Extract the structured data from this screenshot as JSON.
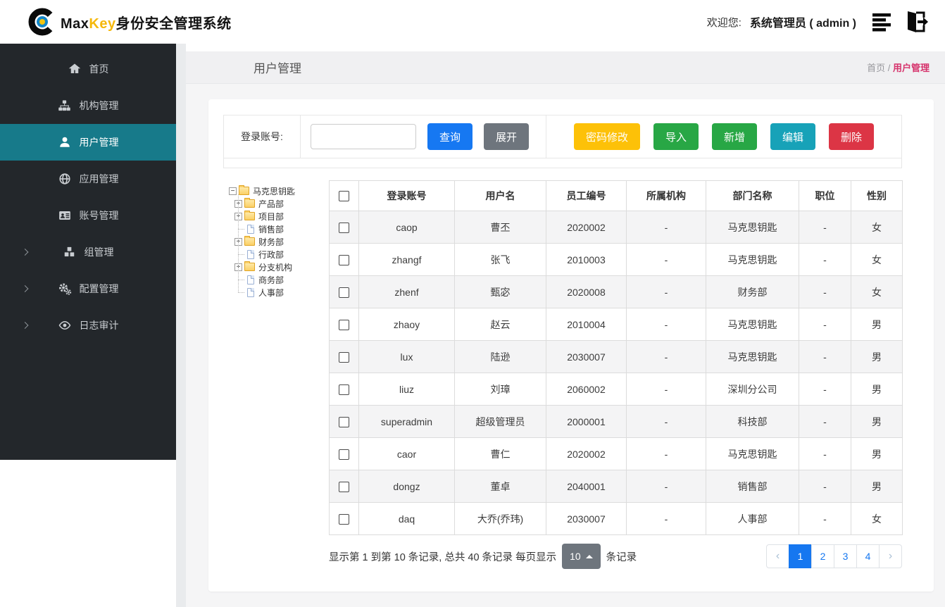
{
  "header": {
    "brand_max": "Max",
    "brand_key": "Key",
    "brand_suffix": "身份安全管理系统",
    "welcome_label": "欢迎您:",
    "welcome_user": "系统管理员 ( admin )",
    "icons": [
      "menu-lines-icon",
      "logout-icon"
    ]
  },
  "sidebar": {
    "items": [
      {
        "label": "首页",
        "icon": "home-icon",
        "active": false,
        "chevron": false
      },
      {
        "label": "机构管理",
        "icon": "sitemap-icon",
        "active": false,
        "chevron": false
      },
      {
        "label": "用户管理",
        "icon": "user-icon",
        "active": true,
        "chevron": false
      },
      {
        "label": "应用管理",
        "icon": "globe-icon",
        "active": false,
        "chevron": false
      },
      {
        "label": "账号管理",
        "icon": "id-card-icon",
        "active": false,
        "chevron": false
      },
      {
        "label": "组管理",
        "icon": "cubes-icon",
        "active": false,
        "chevron": true
      },
      {
        "label": "配置管理",
        "icon": "gears-icon",
        "active": false,
        "chevron": true
      },
      {
        "label": "日志审计",
        "icon": "eye-icon",
        "active": false,
        "chevron": true
      }
    ],
    "active_color": "#177a8a"
  },
  "page": {
    "title": "用户管理",
    "breadcrumb_home": "首页",
    "breadcrumb_sep": "/",
    "breadcrumb_current": "用户管理"
  },
  "toolbar": {
    "search_label": "登录账号:",
    "search_value": "",
    "query_label": "查询",
    "expand_label": "展开",
    "actions": [
      {
        "label": "密码修改",
        "color": "#fdc108"
      },
      {
        "label": "导入",
        "color": "#28a745"
      },
      {
        "label": "新增",
        "color": "#28a745"
      },
      {
        "label": "编辑",
        "color": "#17a2b8"
      },
      {
        "label": "删除",
        "color": "#dc3545"
      }
    ],
    "primary_color": "#1678f2"
  },
  "tree": {
    "root": "马克思钥匙",
    "children": [
      {
        "label": "产品部",
        "type": "branch"
      },
      {
        "label": "项目部",
        "type": "branch"
      },
      {
        "label": "销售部",
        "type": "leaf"
      },
      {
        "label": "财务部",
        "type": "branch"
      },
      {
        "label": "行政部",
        "type": "leaf"
      },
      {
        "label": "分支机构",
        "type": "branch"
      },
      {
        "label": "商务部",
        "type": "leaf"
      },
      {
        "label": "人事部",
        "type": "leaf"
      }
    ]
  },
  "table": {
    "columns": [
      "登录账号",
      "用户名",
      "员工编号",
      "所属机构",
      "部门名称",
      "职位",
      "性别"
    ],
    "rows": [
      [
        "caop",
        "曹丕",
        "2020002",
        "-",
        "马克思钥匙",
        "-",
        "女"
      ],
      [
        "zhangf",
        "张飞",
        "2010003",
        "-",
        "马克思钥匙",
        "-",
        "女"
      ],
      [
        "zhenf",
        "甄宓",
        "2020008",
        "-",
        "财务部",
        "-",
        "女"
      ],
      [
        "zhaoy",
        "赵云",
        "2010004",
        "-",
        "马克思钥匙",
        "-",
        "男"
      ],
      [
        "lux",
        "陆逊",
        "2030007",
        "-",
        "马克思钥匙",
        "-",
        "男"
      ],
      [
        "liuz",
        "刘璋",
        "2060002",
        "-",
        "深圳分公司",
        "-",
        "男"
      ],
      [
        "superadmin",
        "超级管理员",
        "2000001",
        "-",
        "科技部",
        "-",
        "男"
      ],
      [
        "caor",
        "曹仁",
        "2020002",
        "-",
        "马克思钥匙",
        "-",
        "男"
      ],
      [
        "dongz",
        "董卓",
        "2040001",
        "-",
        "销售部",
        "-",
        "男"
      ],
      [
        "daq",
        "大乔(乔玮)",
        "2030007",
        "-",
        "人事部",
        "-",
        "女"
      ]
    ]
  },
  "footer": {
    "summary_prefix": "显示第 1 到第 10 条记录, 总共 40 条记录  每页显示",
    "per_page": "10",
    "summary_suffix": "条记录",
    "pagination": {
      "prev": "‹",
      "pages": [
        "1",
        "2",
        "3",
        "4"
      ],
      "next": "›",
      "active_page": "1"
    }
  }
}
